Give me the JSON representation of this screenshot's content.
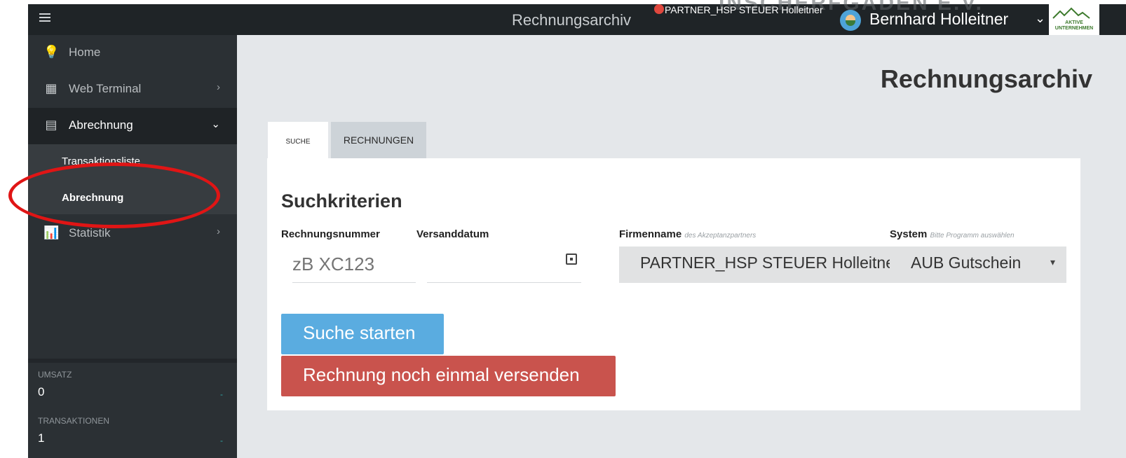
{
  "topbar": {
    "app_title": "Rechnungsarchiv",
    "partner_name": "PARTNER_HSP STEUER Holleitner",
    "background_text": "INSCHERFGADEN E.V.",
    "user_name": "Bernhard Holleitner",
    "user_chevron": "chevron-down-icon",
    "logo": {
      "line1": "AKTIVE",
      "line2": "UNTERNEHMEN"
    }
  },
  "sidebar": {
    "items": [
      {
        "label": "Home",
        "icon": "lightbulb-icon"
      },
      {
        "label": "Web Terminal",
        "icon": "calendar-icon",
        "chevron": "›"
      },
      {
        "label": "Abrechnung",
        "icon": "document-icon",
        "chevron": "⌄"
      },
      {
        "label": "Statistik",
        "icon": "bar-chart-icon",
        "chevron": "›"
      }
    ],
    "subitems": [
      {
        "label": "Transaktionsliste"
      },
      {
        "label": "Abrechnung"
      }
    ],
    "stats": [
      {
        "label": "UMSATZ",
        "value": "0",
        "trend": "-"
      },
      {
        "label": "TRANSAKTIONEN",
        "value": "1",
        "trend": "-"
      }
    ]
  },
  "main": {
    "page_title": "Rechnungsarchiv",
    "tabs": [
      {
        "label": "SUCHE",
        "active": true
      },
      {
        "label": "RECHNUNGEN",
        "active": false
      }
    ],
    "section_title": "Suchkriterien",
    "fields": {
      "rechnungsnummer": {
        "label": "Rechnungsnummer",
        "placeholder": "zB XC123",
        "value": ""
      },
      "versanddatum": {
        "label": "Versanddatum",
        "value": ""
      },
      "firmenname": {
        "label": "Firmenname",
        "hint": "des Akzeptanzpartners",
        "value": "PARTNER_HSP STEUER Holleitner"
      },
      "system": {
        "label": "System",
        "hint": "Bitte Programm auswählen",
        "value": "AUB Gutschein"
      }
    },
    "buttons": {
      "search": "Suche starten",
      "resend": "Rechnung noch einmal versenden"
    }
  },
  "colors": {
    "topbar": "#1f2427",
    "sidebar": "#2b3034",
    "main_bg": "#e4e7ea",
    "search_button": "#5aace0",
    "resend_button": "#c9534d",
    "highlight": "#e01515"
  }
}
